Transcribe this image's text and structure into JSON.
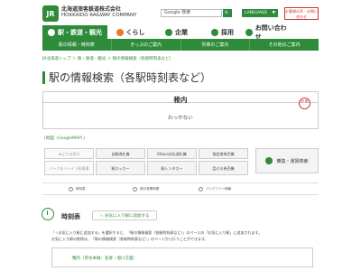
{
  "header": {
    "logo_text": "JR",
    "company_jp": "北海道旅客鉄道株式会社",
    "company_en": "HOKKAIDO RAILWAY COMPANY",
    "search_value": "Google 検索",
    "search_button": "🔍",
    "language_label": "LANGUAGE",
    "language_caret": "▼",
    "contact_box": "お客様の声・お問い合わせ"
  },
  "nav": {
    "tabs": [
      {
        "label": "駅・鉄道・観光",
        "active": true,
        "icon_color": "#ffffff"
      },
      {
        "label": "くらし",
        "active": false,
        "icon_color": "#e87a2c"
      },
      {
        "label": "企業",
        "active": false,
        "icon_color": "#2e8b3a"
      },
      {
        "label": "採用",
        "active": false,
        "icon_color": "#2e8b3a"
      },
      {
        "label": "お問い合わせ",
        "active": false,
        "icon_color": "#2e8b3a"
      }
    ],
    "sub": [
      "駅の情報・時刻表",
      "きっぷのご案内",
      "列車のご案内",
      "その他のご案内"
    ]
  },
  "breadcrumb": "JR北海道トップ ＞ 駅・鉄道・観光 ＞ 駅の情報検索（各駅時刻表など）",
  "page_title": "駅の情報検索（各駅時刻表など）",
  "station": {
    "name": "稚内",
    "kana": "わっかない",
    "badge": "JR 駅"
  },
  "map_link": "[地図（GoogleMAP）]",
  "facilities": [
    "みどりの窓口",
    "自動改札機",
    "Kitaca対応改札機",
    "指定席券売機",
    "バーク＆トレイン駐車場",
    "駅ロッカー",
    "駅レンタカー",
    "話せる券売機"
  ],
  "fare": {
    "label": "乗換・運賃検索"
  },
  "icon_row": [
    "時刻表",
    "駅の営業時間",
    "バリアフリー情報",
    ""
  ],
  "timetable": {
    "title": "時刻表",
    "fav_button": "☆ お気に入り駅に追加する"
  },
  "notice": {
    "line1": "「☆お気に入り駅に追加する」を選択すると、「駅の情報検索（各駅時刻表など）」のページの「お気に入り駅」に追加されます。",
    "line2": "お気に入り駅の削除は、「駅の情報検索（各駅時刻表など）」のページから行うことができます。"
  },
  "tt_list": {
    "item": "稚内（宗谷本線：名寄・旭川方面）"
  },
  "colors": {
    "brand_green": "#2e8b3a",
    "accent_red": "#cc3333"
  }
}
